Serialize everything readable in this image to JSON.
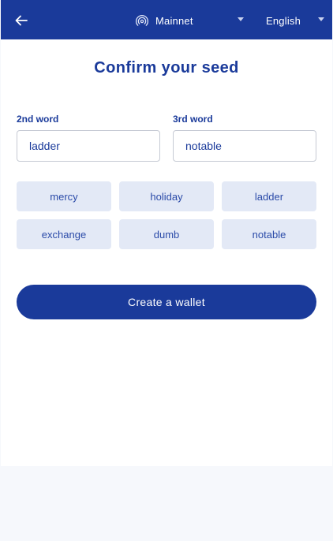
{
  "header": {
    "network_label": "Mainnet",
    "language_label": "English"
  },
  "page": {
    "title": "Confirm your seed"
  },
  "fields": [
    {
      "label": "2nd word",
      "value": "ladder"
    },
    {
      "label": "3rd word",
      "value": "notable"
    }
  ],
  "word_choices": [
    "mercy",
    "holiday",
    "ladder",
    "exchange",
    "dumb",
    "notable"
  ],
  "actions": {
    "create_wallet_label": "Create a wallet"
  },
  "colors": {
    "primary": "#1a3a9a",
    "chip_bg": "#e3e9f6",
    "page_bg": "#f6f8fc"
  },
  "icons": {
    "back": "arrow-left-icon",
    "network": "signal-icon",
    "dropdown": "caret-down-icon"
  }
}
